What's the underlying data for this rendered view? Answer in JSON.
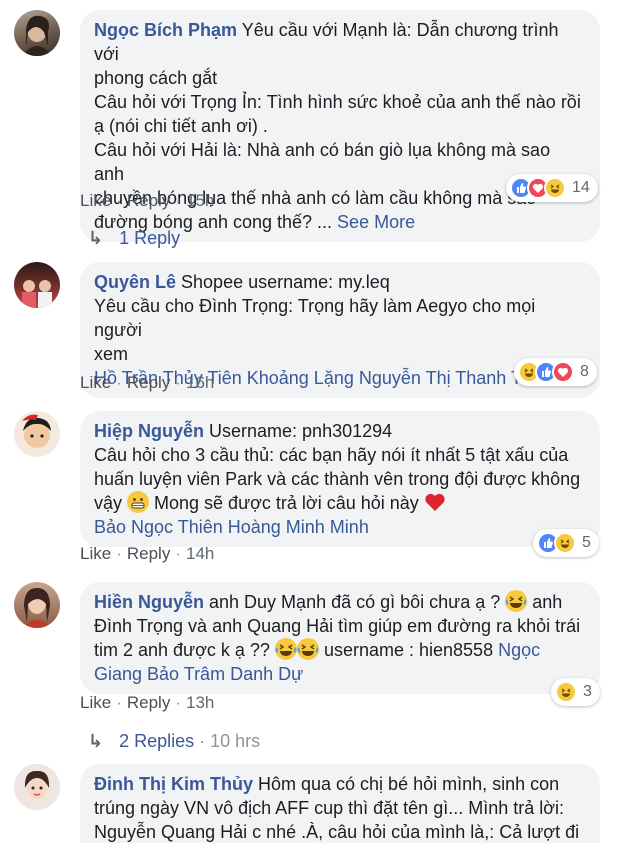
{
  "comments": [
    {
      "name": "Ngọc Bích Phạm",
      "text1": " Yêu cầu với Mạnh là: Dẫn chương trình với",
      "text2": "phong cách gắt",
      "text3": "Câu hỏi với Trọng Ỉn: Tình hình sức khoẻ của anh thế nào rồi",
      "text4": "ạ (nói chi tiết anh ơi) .",
      "text5": "Câu hỏi với Hải là: Nhà anh có bán giò lụa không mà sao anh",
      "text6": "chuyền bóng lụa thế nhà anh có làm cầu không mà sao",
      "text7": "đường bóng anh cong thế? ... ",
      "see_more": "See More",
      "like": "Like",
      "reply": "Reply",
      "time": "15h",
      "reaction_count": "14",
      "replies": "1 Reply"
    },
    {
      "name": "Quyên Lê",
      "text1": " Shopee username: my.leq",
      "text2": "Yêu cầu cho Đình Trọng: Trọng hãy làm Aegyo cho mọi người",
      "text3": "xem",
      "tags": "Hồ Trần Thủy Tiên Khoảng Lặng Nguyễn Thị Thanh Tâm",
      "like": "Like",
      "reply": "Reply",
      "time": "16h",
      "reaction_count": "8"
    },
    {
      "name": "Hiệp Nguyễn",
      "text1": " Username: pnh301294",
      "text2": "Câu hỏi cho 3 cầu thủ: các bạn hãy nói ít nhất 5 tật xấu của",
      "text3": "huấn luyện viên Park và các thành vên trong đội được không",
      "text4a": "vậy ",
      "text4b": " Mong sẽ được trả lời câu hỏi này ",
      "tags": "Bảo Ngọc Thiên Hoàng Minh Minh",
      "like": "Like",
      "reply": "Reply",
      "time": "14h",
      "reaction_count": "5"
    },
    {
      "name": "Hiền Nguyễn",
      "text1": " anh Duy Mạnh đã có gì bôi chưa ạ ? ",
      "text1b": " anh",
      "text2": "Đình Trọng và anh Quang Hải tìm giúp em đường ra khỏi trái",
      "text3a": "tim 2 anh được k ạ ?? ",
      "text3b": " username : hien8558 ",
      "tag1": "Ngọc",
      "tag2": "Giang Bảo Trâm Danh Dự",
      "like": "Like",
      "reply": "Reply",
      "time": "13h",
      "reaction_count": "3",
      "replies": "2 Replies",
      "replies_time": "10 hrs"
    },
    {
      "name": "Đinh Thị Kim Thủy",
      "text1": " Hôm qua có chị bé hỏi mình, sinh con",
      "text2": "trúng ngày VN vô địch AFF cup thì đặt tên gì... Mình trả lời:",
      "text3": "Nguyễn Quang Hải c nhé .À, câu hỏi của mình là,: Cả lượt đi"
    }
  ],
  "separator": "·"
}
